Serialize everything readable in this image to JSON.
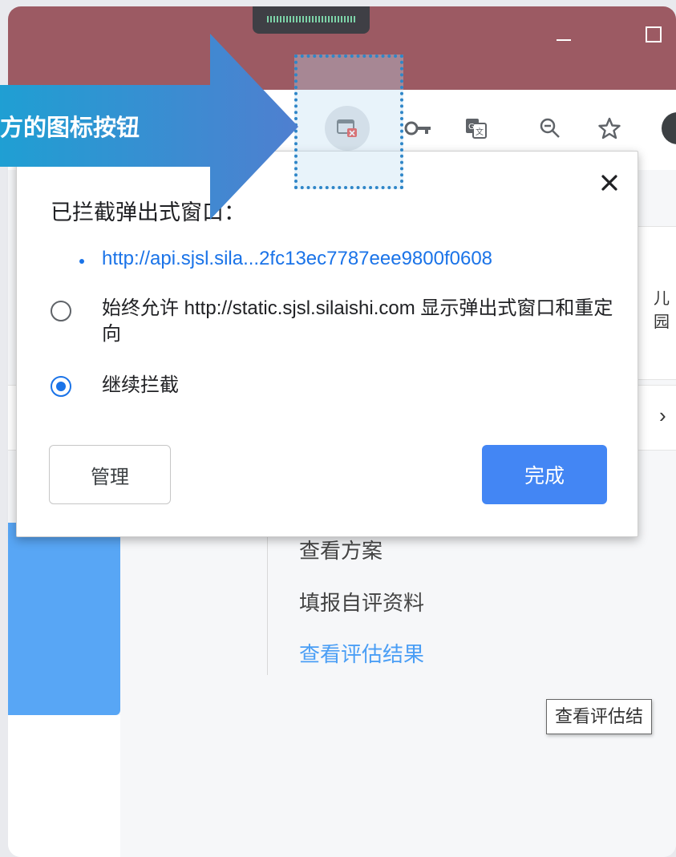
{
  "browser": {
    "window_controls": [
      "minimize",
      "maximize"
    ],
    "toolbar_icons": [
      "popup-blocked-icon",
      "key-icon",
      "translate-icon",
      "zoom-out-icon",
      "star-icon",
      "profile-avatar-icon"
    ]
  },
  "annotation": {
    "arrow_text": "方的图标按钮",
    "colors": {
      "arrow_start": "#1f9fd3",
      "arrow_end": "#4f7fd0",
      "highlight_border": "#2f86c8"
    }
  },
  "popup": {
    "title": "已拦截弹出式窗口：",
    "blocked_url": "http://api.sjsl.sila...2fc13ec7787eee9800f0608",
    "option_allow": "始终允许 http://static.sjsl.silaishi.com 显示弹出式窗口和重定向",
    "option_allow_selected": false,
    "option_block": "继续拦截",
    "option_block_selected": true,
    "manage_label": "管理",
    "done_label": "完成"
  },
  "page": {
    "card_fragment": "儿园",
    "menu_items": [
      {
        "label": "查看方案",
        "is_link": false
      },
      {
        "label": "填报自评资料",
        "is_link": false
      },
      {
        "label": "查看评估结果",
        "is_link": true
      }
    ],
    "tooltip": "查看评估结"
  },
  "colors": {
    "titlebar": "#9c5a63",
    "accent": "#1a73e8",
    "done_button": "#4386f4",
    "sidebar_blue": "#58a6f5"
  }
}
